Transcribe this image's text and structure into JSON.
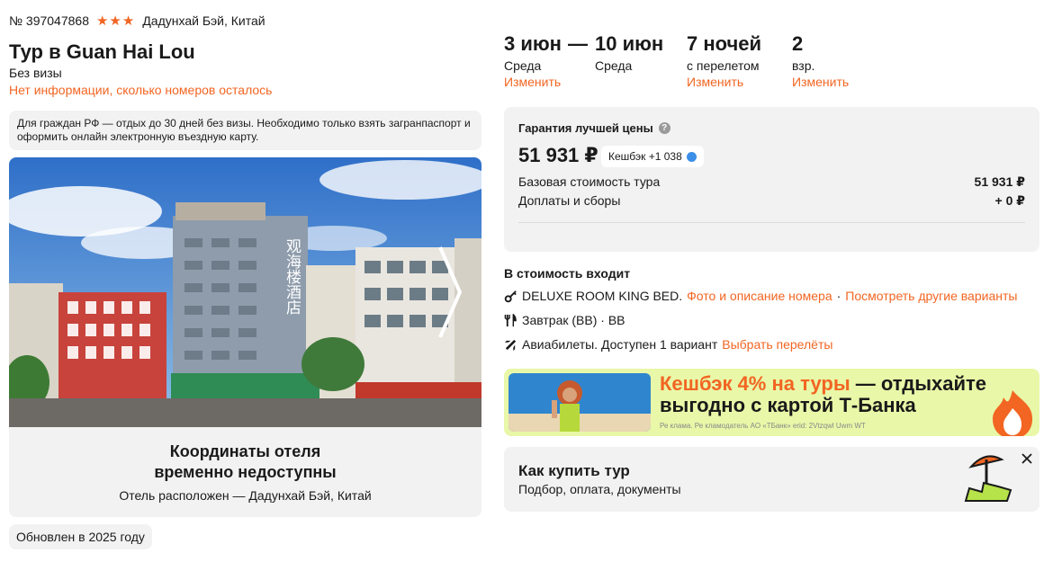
{
  "tour": {
    "number": "№ 397047868",
    "stars_text": "★★★",
    "location": "Дадунхай Бэй, Китай",
    "title": "Тур в Guan Hai Lou",
    "visa": "Без визы",
    "rooms_info": "Нет информации, сколько номеров осталось",
    "visa_note": "Для граждан РФ — отдых до 30 дней без визы. Необходимо только взять загранпаспорт и оформить онлайн электронную въездную карту."
  },
  "photo": {
    "signboard": "观海楼酒店"
  },
  "coords": {
    "title_line1": "Координаты отеля",
    "title_line2": "временно недоступны",
    "subtitle": "Отель расположен — Дадунхай Бэй, Китай"
  },
  "updated": "Обновлен в 2025 году",
  "dates": {
    "from": "3 июн",
    "dash": "—",
    "to": "10 июн",
    "from_day": "Среда",
    "to_day": "Среда",
    "nights": "7 ночей",
    "nights_note": "с перелетом",
    "guests": "2",
    "guests_note": "взр.",
    "change_label": "Изменить"
  },
  "price": {
    "guarantee": "Гарантия лучшей цены",
    "help_symbol": "?",
    "total": "51 931 ₽",
    "cashback": "Кешбэк +1 038",
    "base_label": "Базовая стоимость тура",
    "base_value": "51 931 ₽",
    "extra_label": "Доплаты и сборы",
    "extra_value": "+ 0 ₽"
  },
  "includes": {
    "title": "В стоимость входит",
    "room": "DELUXE ROOM KING BED.",
    "room_link": "Фото и описание номера",
    "sep": "·",
    "room_link2": "Посмотреть другие варианты",
    "meal": "Завтрак (BB) · BB",
    "flights": "Авиабилеты. Доступен 1 вариант",
    "flights_link": "Выбрать перелёты"
  },
  "promo": {
    "accent": "Кешбэк 4% на туры",
    "rest": " — отдыхайте выгодно с картой Т-Банка",
    "legal": "Ре клама. Ре кламодатель АО «ТБанк» erid: 2Vtzqwl Uwm WT"
  },
  "howto": {
    "title": "Как купить тур",
    "subtitle": "Подбор, оплата, документы"
  },
  "colors": {
    "accent": "#f26522",
    "card_bg": "#f2f2f2",
    "promo_bg": "#e9f7a8"
  }
}
